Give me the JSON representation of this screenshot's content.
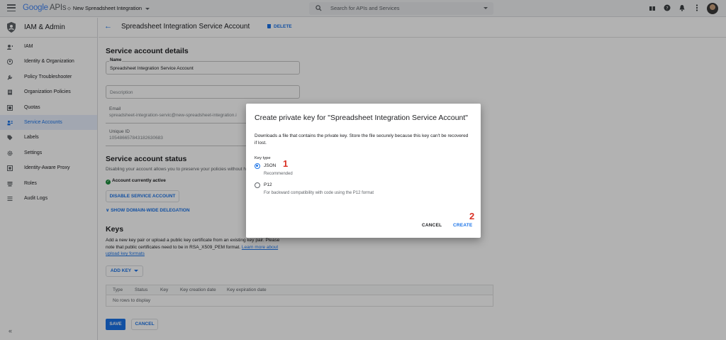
{
  "topbar": {
    "logo_google": "Google",
    "logo_apis": "APIs",
    "project": "New Spreadsheet Integration",
    "search_placeholder": "Search for APIs and Services"
  },
  "sidebar": {
    "title": "IAM & Admin",
    "items": [
      {
        "label": "IAM",
        "icon": "person-add-icon"
      },
      {
        "label": "Identity & Organization",
        "icon": "account-circle-icon"
      },
      {
        "label": "Policy Troubleshooter",
        "icon": "wrench-icon"
      },
      {
        "label": "Organization Policies",
        "icon": "document-icon"
      },
      {
        "label": "Quotas",
        "icon": "table-icon"
      },
      {
        "label": "Service Accounts",
        "icon": "service-account-icon"
      },
      {
        "label": "Labels",
        "icon": "label-icon"
      },
      {
        "label": "Settings",
        "icon": "gear-icon"
      },
      {
        "label": "Identity-Aware Proxy",
        "icon": "grid-icon"
      },
      {
        "label": "Roles",
        "icon": "layers-icon"
      },
      {
        "label": "Audit Logs",
        "icon": "list-icon"
      }
    ],
    "collapse": "«"
  },
  "main": {
    "title": "Spreadsheet Integration Service Account",
    "delete_label": "DELETE",
    "details_heading": "Service account details",
    "name_label": "Name",
    "name_value": "Spreadsheet Integration Service Account",
    "description_placeholder": "Description",
    "email_label": "Email",
    "email_value": "spreadsheet-integration-servic@new-spreadsheet-integration.i",
    "uid_label": "Unique ID",
    "uid_value": "105486657843182630683",
    "status_heading": "Service account status",
    "status_desc": "Disabling your account allows you to preserve your policies without ha",
    "status_active": "Account currently active",
    "disable_btn": "DISABLE SERVICE ACCOUNT",
    "delegation_link": "SHOW DOMAIN-WIDE DELEGATION",
    "keys_heading": "Keys",
    "keys_desc_1": "Add a new key pair or upload a public key certificate from an existing key pair. Please",
    "keys_desc_2": "note that public certificates need to be in RSA_X509_PEM format.",
    "keys_learn_1": "Learn more about",
    "keys_learn_2": "upload key formats",
    "add_key_btn": "ADD KEY",
    "table_headers": [
      "Type",
      "Status",
      "Key",
      "Key creation date",
      "Key expiration date"
    ],
    "table_empty": "No rows to display",
    "save_btn": "SAVE",
    "cancel_btn": "CANCEL"
  },
  "dialog": {
    "title": "Create private key for \"Spreadsheet Integration Service Account\"",
    "desc": "Downloads a file that contains the private key. Store the file securely because this key can't be recovered if lost.",
    "key_type_label": "Key type",
    "json_label": "JSON",
    "json_sub": "Recommended",
    "p12_label": "P12",
    "p12_sub": "For backward compatibility with code using the P12 format",
    "selected": "JSON",
    "cancel": "CANCEL",
    "create": "CREATE",
    "step1": "1",
    "step2": "2"
  },
  "colors": {
    "accent": "#1a73e8",
    "step_marker": "#d93025",
    "success": "#1e8e3e"
  }
}
